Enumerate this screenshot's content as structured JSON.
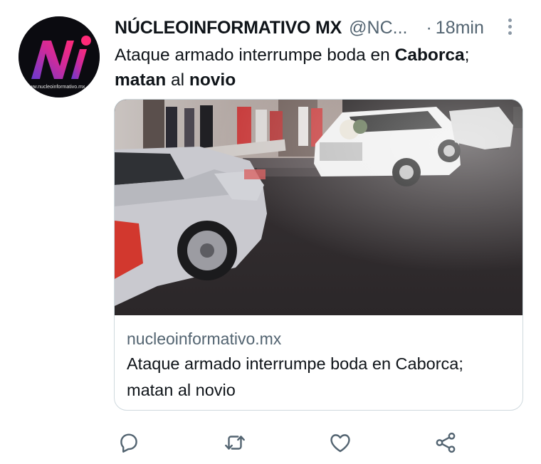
{
  "author": {
    "display_name": "NÚCLEOINFORMATIVO MX",
    "handle": "@NC...",
    "separator": "·",
    "time": "18min",
    "avatar_watermark": "www.nucleoinformativo.mx"
  },
  "tweet": {
    "segments": [
      {
        "text": "Ataque armado interrumpe boda en ",
        "bold": false
      },
      {
        "text": "Caborca",
        "bold": true
      },
      {
        "text": ";",
        "bold": false
      },
      {
        "text": "matan",
        "bold": true
      },
      {
        "text": " al ",
        "bold": false
      },
      {
        "text": "novio",
        "bold": true
      }
    ]
  },
  "card": {
    "domain": "nucleoinformativo.mx",
    "title": "Ataque armado interrumpe boda en Caborca; matan al novio"
  },
  "actions": {
    "reply_icon": "reply-icon",
    "retweet_icon": "retweet-icon",
    "like_icon": "like-icon",
    "share_icon": "share-icon"
  },
  "colors": {
    "text_primary": "#0f1419",
    "text_secondary": "#536471",
    "border": "#cfd9de",
    "icon": "#536471",
    "brand_pink": "#e8267a",
    "brand_purple": "#7a3cc8"
  }
}
